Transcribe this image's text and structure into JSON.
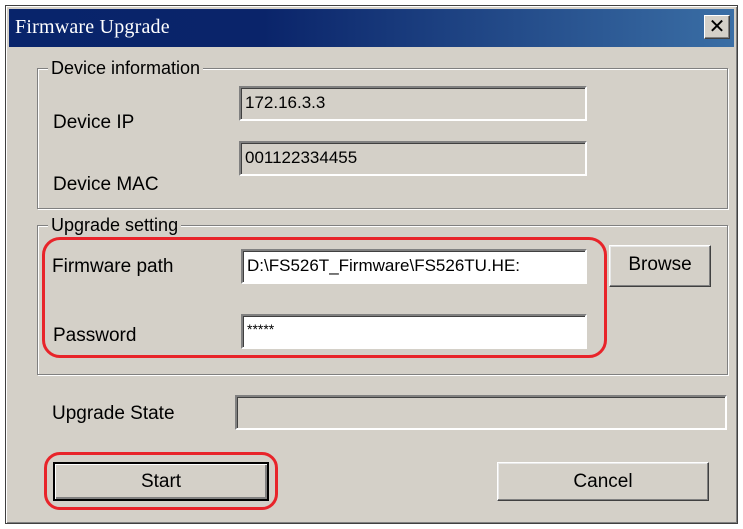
{
  "window": {
    "title": "Firmware Upgrade",
    "close_glyph": "✕"
  },
  "device_info": {
    "legend": "Device information",
    "ip_label": "Device IP",
    "ip_value": "172.16.3.3",
    "mac_label": "Device MAC",
    "mac_value": "001122334455"
  },
  "upgrade_setting": {
    "legend": "Upgrade setting",
    "firmware_path_label": "Firmware path",
    "firmware_path_value": "D:\\FS526T_Firmware\\FS526TU.HE:",
    "browse_label": "Browse",
    "password_label": "Password",
    "password_value": "*****"
  },
  "upgrade_state": {
    "label": "Upgrade State",
    "value": ""
  },
  "actions": {
    "start_label": "Start",
    "cancel_label": "Cancel"
  },
  "annotation": {
    "highlight_color": "#e8242a"
  },
  "icons": {
    "close": "close-icon"
  }
}
